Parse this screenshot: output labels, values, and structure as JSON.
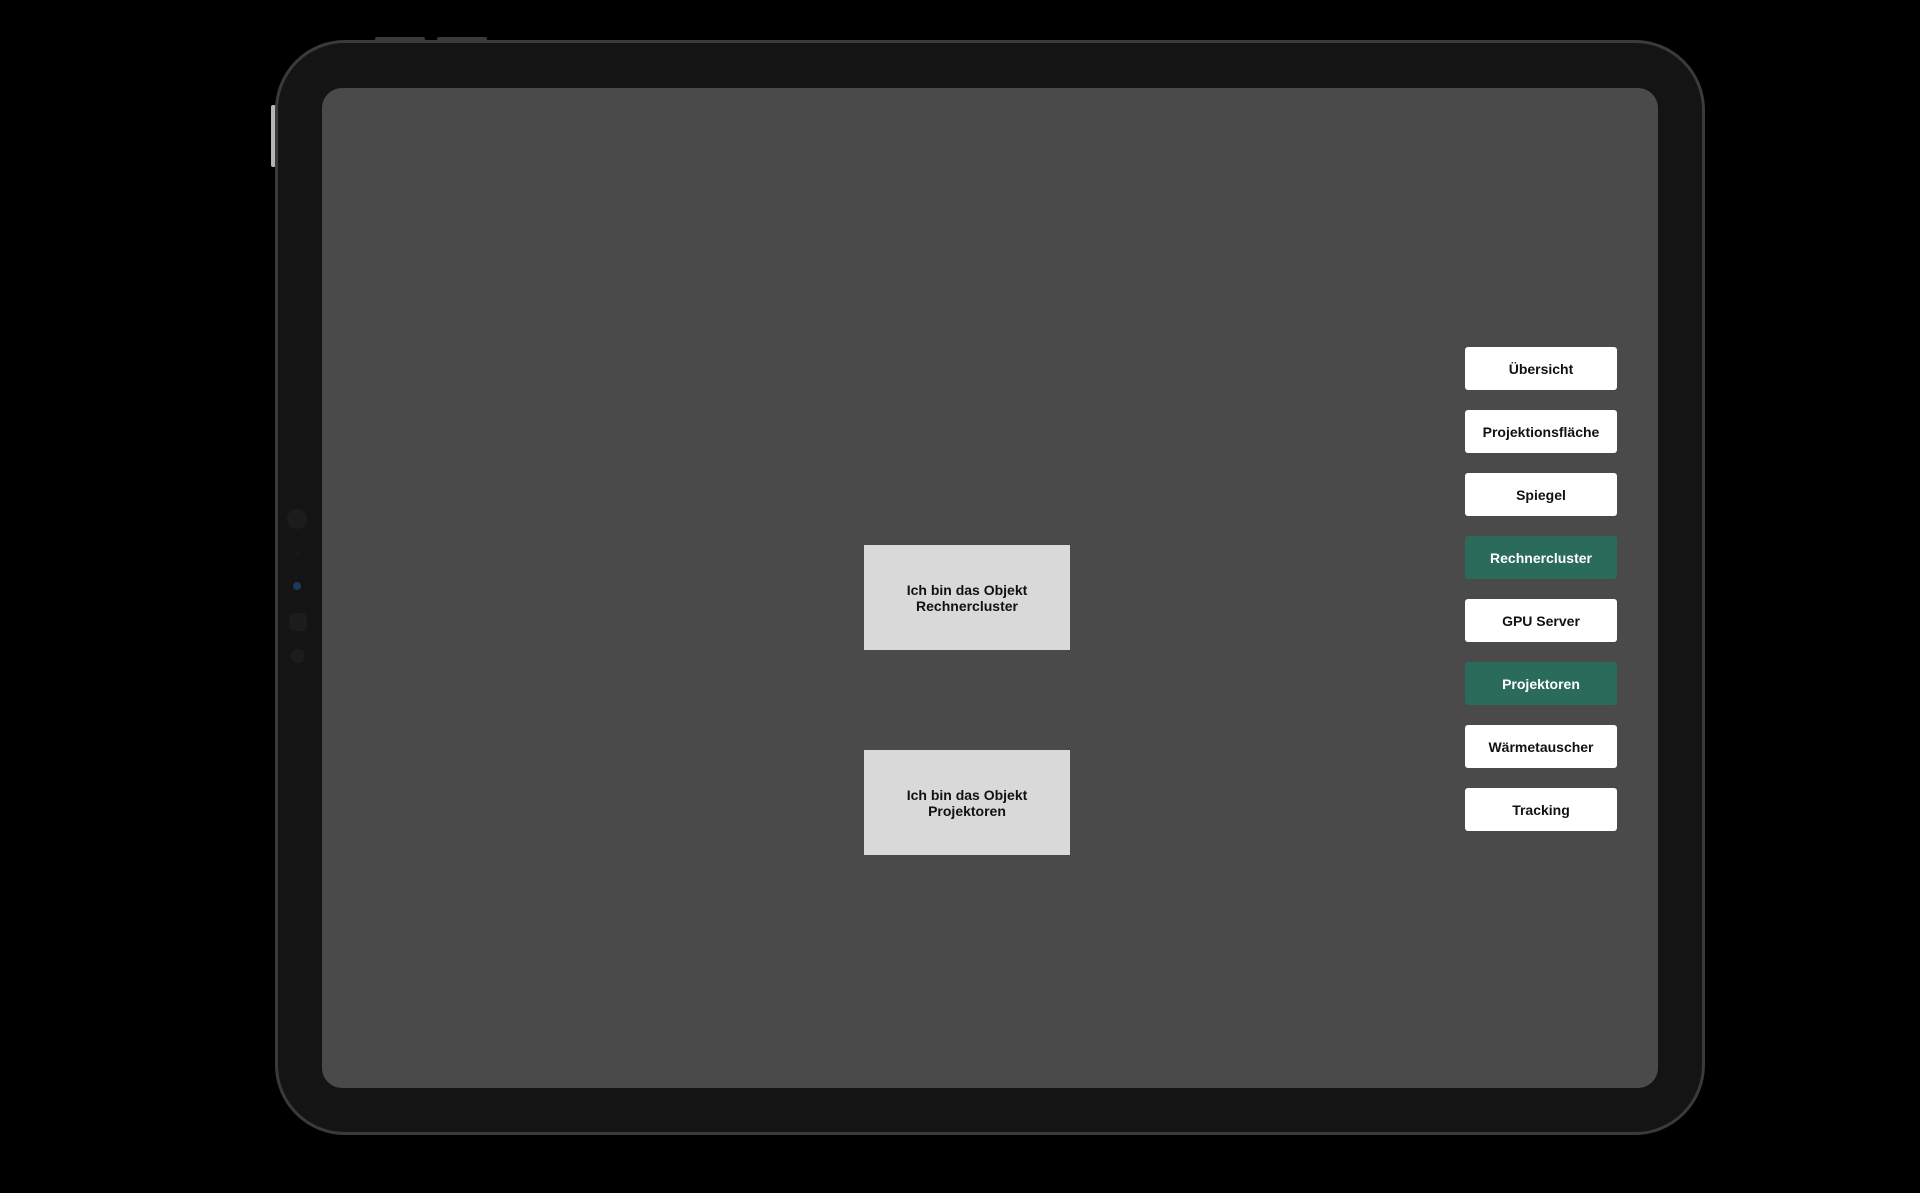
{
  "colors": {
    "screen_background": "#4a4a4a",
    "object_box": "#d9d9d9",
    "button_default": "#ffffff",
    "button_active": "#2b6b5b"
  },
  "objects": [
    {
      "line1": "Ich bin das Objekt",
      "line2": "Rechnercluster"
    },
    {
      "line1": "Ich bin das Objekt",
      "line2": "Projektoren"
    }
  ],
  "nav": {
    "items": [
      {
        "label": "Übersicht",
        "active": false
      },
      {
        "label": "Projektionsfläche",
        "active": false
      },
      {
        "label": "Spiegel",
        "active": false
      },
      {
        "label": "Rechnercluster",
        "active": true
      },
      {
        "label": "GPU Server",
        "active": false
      },
      {
        "label": "Projektoren",
        "active": true
      },
      {
        "label": "Wärmetauscher",
        "active": false
      },
      {
        "label": "Tracking",
        "active": false
      }
    ]
  }
}
